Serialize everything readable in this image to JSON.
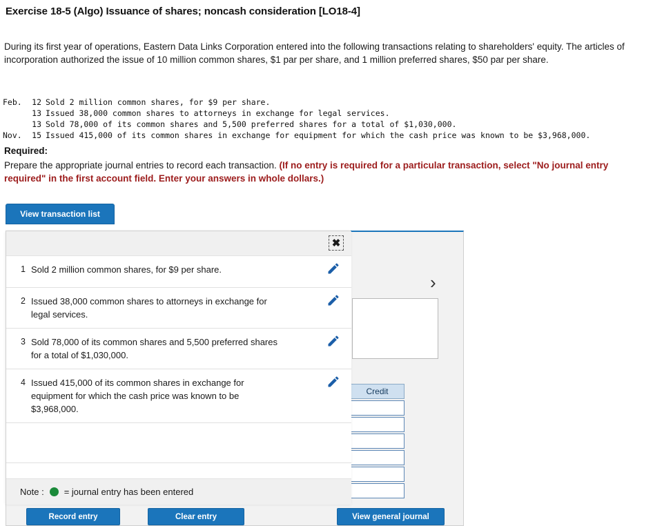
{
  "exercise": {
    "title": "Exercise 18-5 (Algo) Issuance of shares; noncash consideration [LO18-4]",
    "intro": "During its first year of operations, Eastern Data Links Corporation entered into the following transactions relating to shareholders' equity. The articles of incorporation authorized the issue of 10 million common shares, $1 par per share, and 1 million preferred shares, $50 par per share.",
    "transactions": [
      {
        "month": "Feb.",
        "day": "12",
        "text": "Sold 2 million common shares, for $9 per share."
      },
      {
        "month": "",
        "day": "13",
        "text": "Issued 38,000 common shares to attorneys in exchange for legal services."
      },
      {
        "month": "",
        "day": "13",
        "text": "Sold 78,000 of its common shares and 5,500 preferred shares for a total of $1,030,000."
      },
      {
        "month": "Nov.",
        "day": "15",
        "text": "Issued 415,000 of its common shares in exchange for equipment for which the cash price was known to be $3,968,000."
      }
    ],
    "required_heading": "Required:",
    "required_text_plain": "Prepare the appropriate journal entries to record each transaction. ",
    "required_text_red": "(If no entry is required for a particular transaction, select \"No journal entry required\" in the first account field. Enter your answers in whole dollars.)"
  },
  "toolbar": {
    "view_transaction_list": "View transaction list"
  },
  "journal_panel": {
    "chevron_icon": "chevron-right-icon",
    "credit_header": "Credit",
    "credit_rows": [
      "",
      "",
      "",
      "",
      "",
      ""
    ],
    "record_entry": "Record entry",
    "clear_entry": "Clear entry",
    "view_general_journal": "View general journal"
  },
  "modal": {
    "close_icon": "close-icon",
    "rows": [
      {
        "num": "1",
        "text": "Sold 2 million common shares, for $9 per share.",
        "edit_icon": "pencil-icon"
      },
      {
        "num": "2",
        "text": "Issued 38,000 common shares to attorneys in exchange for legal services.",
        "edit_icon": "pencil-icon"
      },
      {
        "num": "3",
        "text": "Sold 78,000 of its common shares and 5,500 preferred shares for a total of $1,030,000.",
        "edit_icon": "pencil-icon"
      },
      {
        "num": "4",
        "text": "Issued 415,000 of its common shares in exchange for equipment for which the cash price was known to be $3,968,000.",
        "edit_icon": "pencil-icon"
      }
    ],
    "note_prefix": "Note :",
    "note_suffix": "= journal entry has been entered",
    "note_dot_color": "#1b8a3a"
  },
  "colors": {
    "accent_blue": "#1b75bb",
    "red_text": "#9c1c1c",
    "panel_gray": "#f2f2f2"
  }
}
